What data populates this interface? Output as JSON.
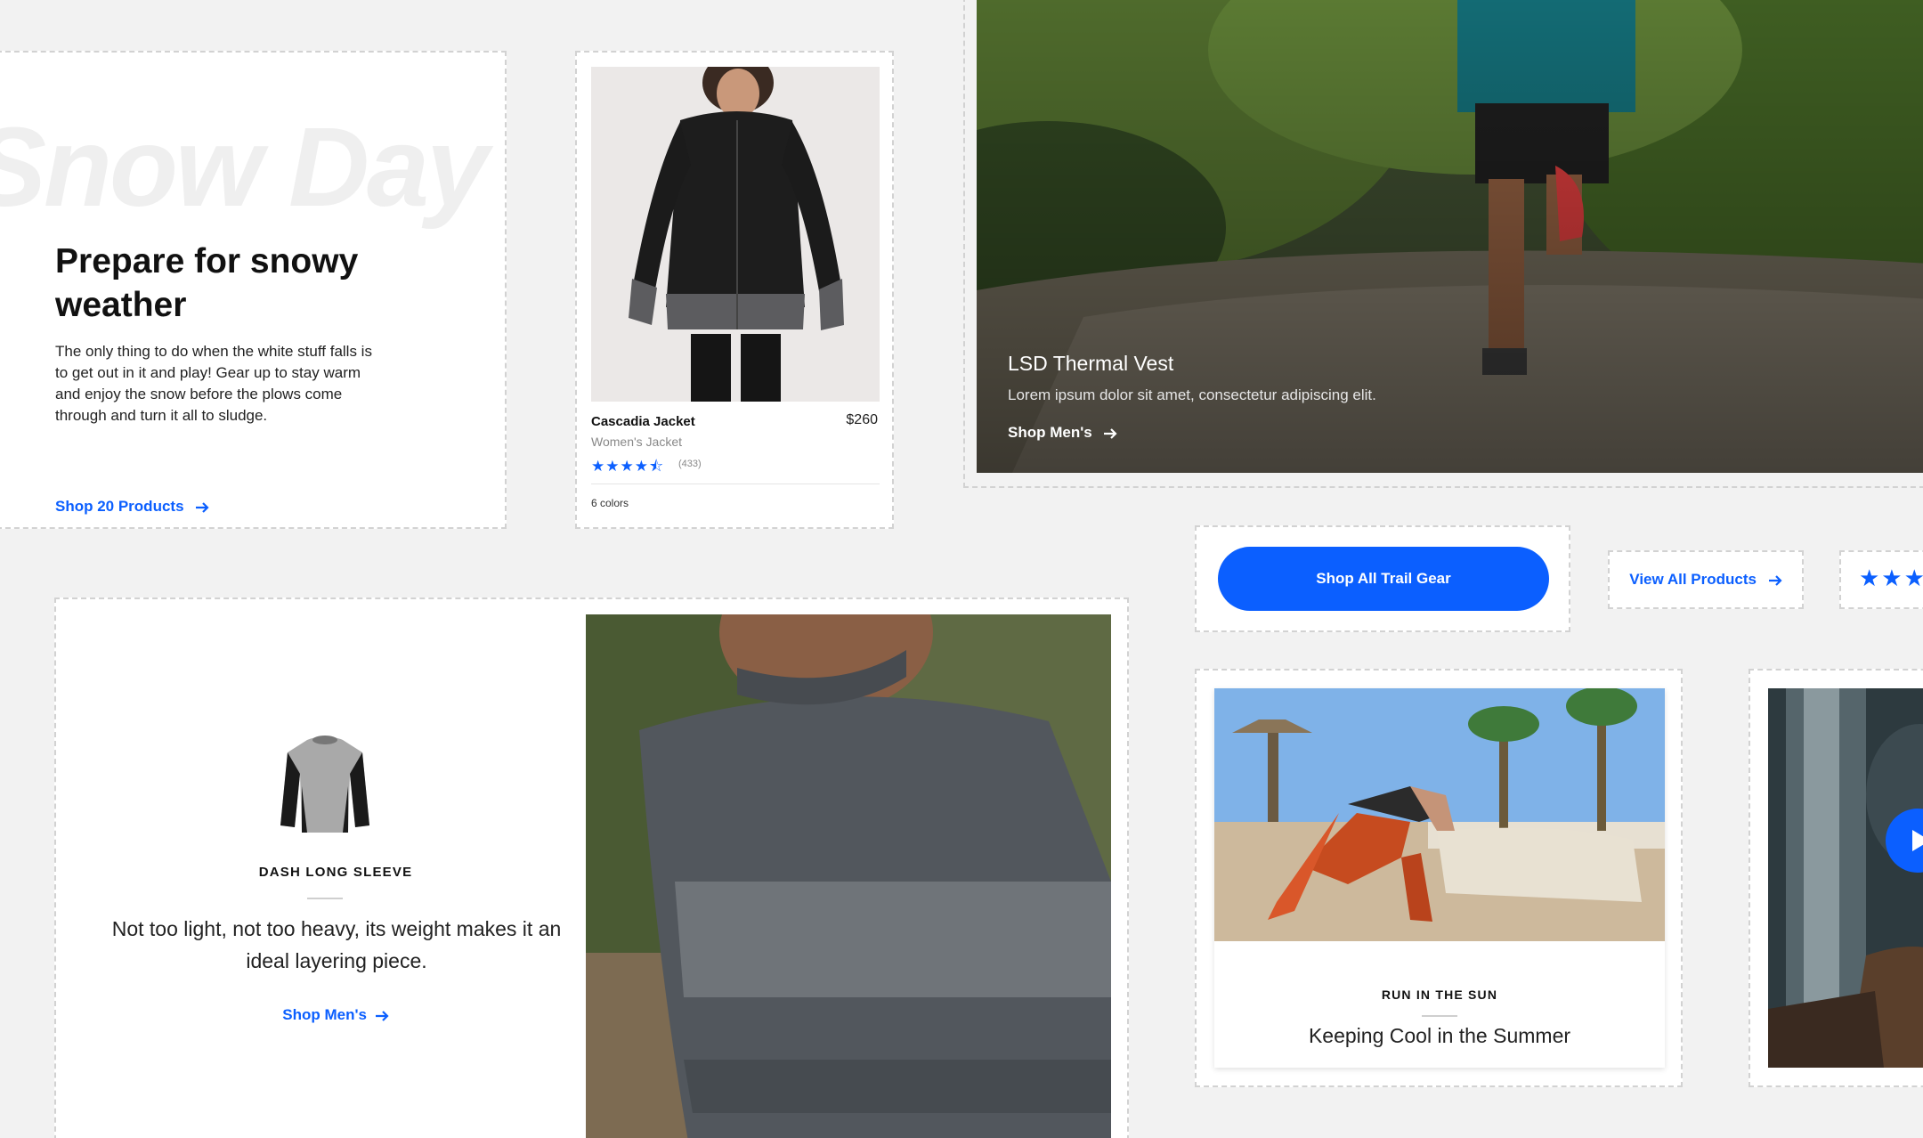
{
  "colors": {
    "accent": "#0b5fff",
    "background": "#f2f2f2",
    "card": "#ffffff"
  },
  "snow_card": {
    "bg_word": "Snow Day",
    "title": "Prepare for snowy weather",
    "body": "The only thing to do when the white stuff falls is to get out in it and play! Gear up to stay warm and enjoy the snow before the plows come through and turn it all to sludge.",
    "link": "Shop 20 Products",
    "link_icon": "arrow-right-icon"
  },
  "product_card": {
    "name": "Cascadia Jacket",
    "price": "$260",
    "subtitle": "Women's Jacket",
    "rating": 4.5,
    "rating_max": 5,
    "stars": "★★★★⯪",
    "review_count": "(433)",
    "colors_label": "6 colors",
    "image_icon": "black-jacket-photo"
  },
  "hero_card": {
    "title": "LSD Thermal Vest",
    "body": "Lorem ipsum dolor sit amet, consectetur adipiscing elit.",
    "link": "Shop Men's",
    "link_icon": "arrow-right-icon"
  },
  "dash_card": {
    "label": "DASH LONG SLEEVE",
    "body": "Not too light, not too heavy, its weight makes it an ideal layering piece.",
    "link": "Shop Men's",
    "link_icon": "arrow-right-icon"
  },
  "buttons": {
    "trail": "Shop All Trail Gear",
    "view_all": "View All Products",
    "view_all_icon": "arrow-right-icon",
    "stars": "★★★"
  },
  "sun_card": {
    "label": "RUN IN THE SUN",
    "title": "Keeping Cool in the Summer"
  },
  "video_card": {
    "play_icon": "play-icon"
  }
}
